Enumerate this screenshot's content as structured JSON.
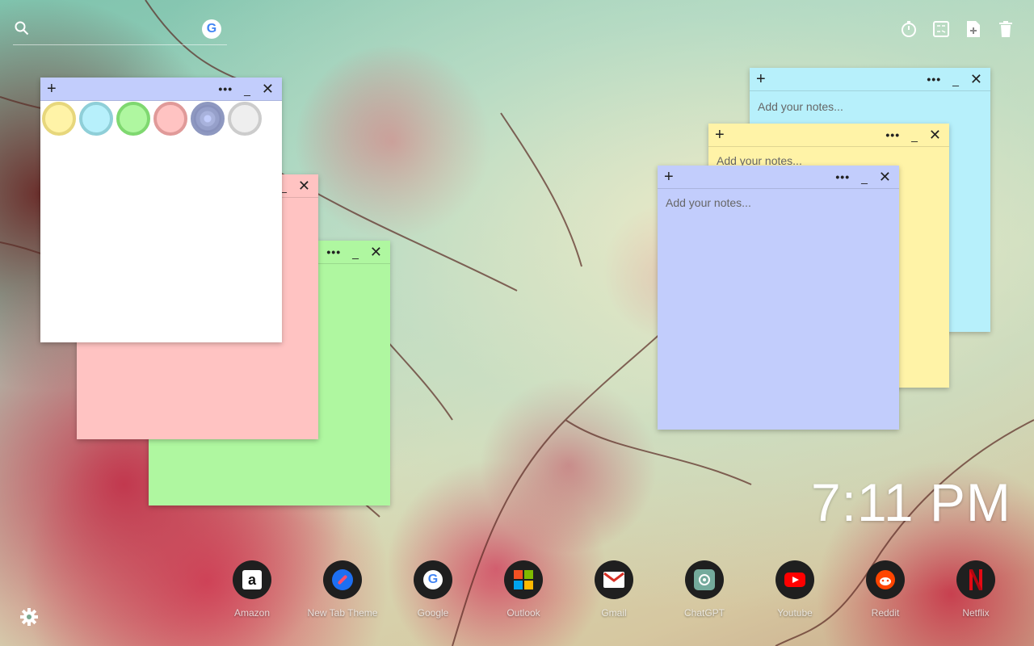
{
  "colors": {
    "note_blue": "#c2cdfc",
    "note_cyan": "#b7f0fb",
    "note_yellow": "#fff3a7",
    "note_pink": "#ffc3c2",
    "note_green": "#aff7a0",
    "note_white": "#ffffff"
  },
  "toolbar": {
    "icons": [
      "search-icon",
      "google-icon",
      "timer-icon",
      "calculator-icon",
      "add-note-icon",
      "trash-icon"
    ]
  },
  "notes": {
    "cyan": {
      "placeholder": "Add your notes..."
    },
    "yellow": {
      "placeholder": "Add your notes..."
    },
    "blue": {
      "placeholder": "Add your notes..."
    }
  },
  "note_controls": {
    "add": "+",
    "more": "•••",
    "minimize": "_",
    "close": "✕"
  },
  "palette": {
    "swatches": [
      {
        "name": "yellow",
        "fill": "#fff3a7",
        "border": "#e7d77c"
      },
      {
        "name": "cyan",
        "fill": "#b7f0fb",
        "border": "#8fcfd8"
      },
      {
        "name": "green",
        "fill": "#aff7a0",
        "border": "#7fd870"
      },
      {
        "name": "pink",
        "fill": "#ffc3c2",
        "border": "#e09a99"
      },
      {
        "name": "blue",
        "fill": "#c2cdfc",
        "border": "#8e98c0"
      },
      {
        "name": "gray",
        "fill": "#eeeeee",
        "border": "#cccccc"
      }
    ],
    "selected": "blue"
  },
  "clock": {
    "time": "7:11 PM"
  },
  "dock": {
    "apps": [
      {
        "label": "Amazon",
        "icon": "amazon-icon"
      },
      {
        "label": "New Tab Theme",
        "icon": "new-tab-theme-icon"
      },
      {
        "label": "Google",
        "icon": "google-icon"
      },
      {
        "label": "Outlook",
        "icon": "outlook-icon"
      },
      {
        "label": "Gmail",
        "icon": "gmail-icon"
      },
      {
        "label": "ChatGPT",
        "icon": "chatgpt-icon"
      },
      {
        "label": "Youtube",
        "icon": "youtube-icon"
      },
      {
        "label": "Reddit",
        "icon": "reddit-icon"
      },
      {
        "label": "Netflix",
        "icon": "netflix-icon"
      }
    ]
  },
  "google_badge": "G"
}
